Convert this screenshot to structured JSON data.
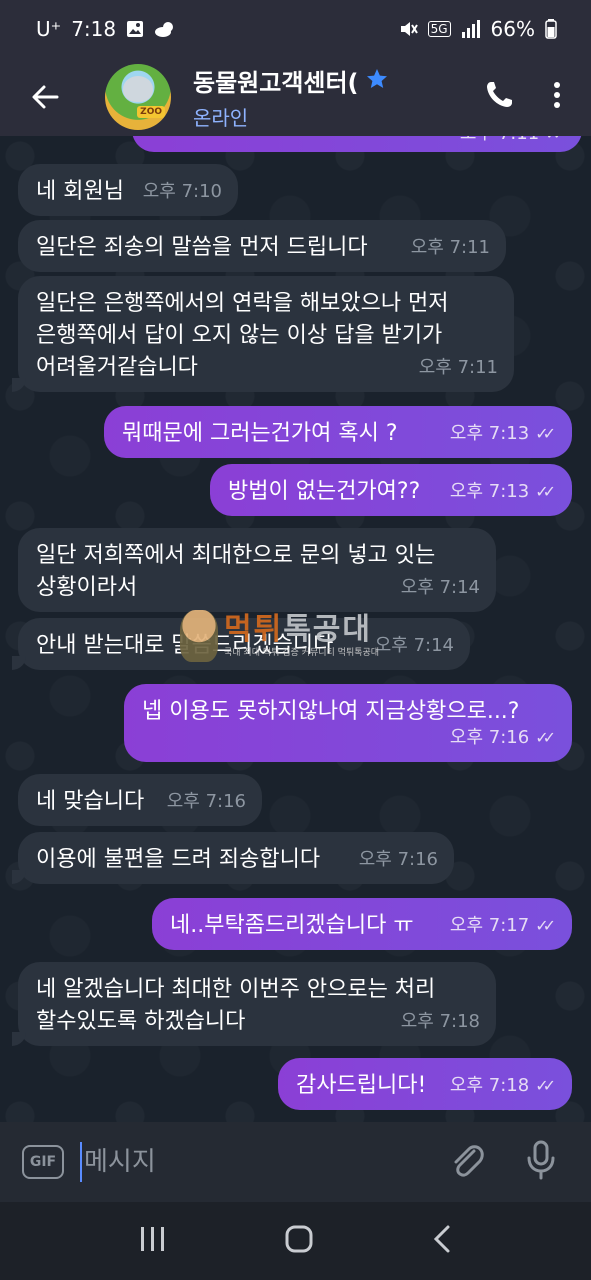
{
  "status_bar": {
    "time": "7:18",
    "carrier": "U⁺",
    "network": "5G",
    "battery": "66%"
  },
  "header": {
    "title": "동물원고객센터(",
    "status": "온라인",
    "avatar_badge": "ZOO"
  },
  "watermark": {
    "brand_left": "먹튀",
    "brand_right": "톡공대",
    "tagline": "국내 최대 먹튀 검증 커뮤니티 먹튀톡공대"
  },
  "messages": [
    {
      "dir": "out",
      "text": "",
      "time": "오후 7:11"
    },
    {
      "dir": "in",
      "text": "네 회원님",
      "time": "오후 7:10"
    },
    {
      "dir": "in",
      "text": "일단은 죄송의 말씀을 먼저 드립니다",
      "time": "오후 7:11"
    },
    {
      "dir": "in",
      "lines": [
        "일단은 은행쪽에서의 연락을 해보았으나 먼저",
        "은행쪽에서 답이 오지 않는 이상 답을 받기가",
        "어려울거같습니다"
      ],
      "time": "오후 7:11"
    },
    {
      "dir": "out",
      "text": "뭐때문에 그러는건가여 혹시 ?",
      "time": "오후 7:13"
    },
    {
      "dir": "out",
      "text": "방법이 없는건가여??",
      "time": "오후 7:13"
    },
    {
      "dir": "in",
      "lines": [
        "일단 저희쪽에서 최대한으로 문의 넣고 잇는",
        "상황이라서"
      ],
      "time": "오후 7:14"
    },
    {
      "dir": "in",
      "text": "안내 받는대로 말씀드리겠습니다",
      "time": "오후 7:14"
    },
    {
      "dir": "out",
      "text": "넵 이용도 못하지않나여 지금상황으로...?",
      "time": "오후 7:16"
    },
    {
      "dir": "in",
      "text": "네 맞습니다",
      "time": "오후 7:16"
    },
    {
      "dir": "in",
      "text": "이용에 불편을 드려 죄송합니다",
      "time": "오후 7:16"
    },
    {
      "dir": "out",
      "text": "네..부탁좀드리겠습니다 ㅠ",
      "time": "오후 7:17"
    },
    {
      "dir": "in",
      "lines": [
        "네 알겠습니다 최대한 이번주 안으로는 처리",
        "할수있도록 하겠습니다"
      ],
      "time": "오후 7:18"
    },
    {
      "dir": "out",
      "text": "감사드립니다!",
      "time": "오후 7:18"
    }
  ],
  "input": {
    "gif_label": "GIF",
    "placeholder": "메시지"
  },
  "colors": {
    "outgoing_bubble": "#8b3fd6",
    "incoming_bubble": "#2b333e",
    "online_status": "#8fb3ff",
    "star": "#3d8bff"
  }
}
